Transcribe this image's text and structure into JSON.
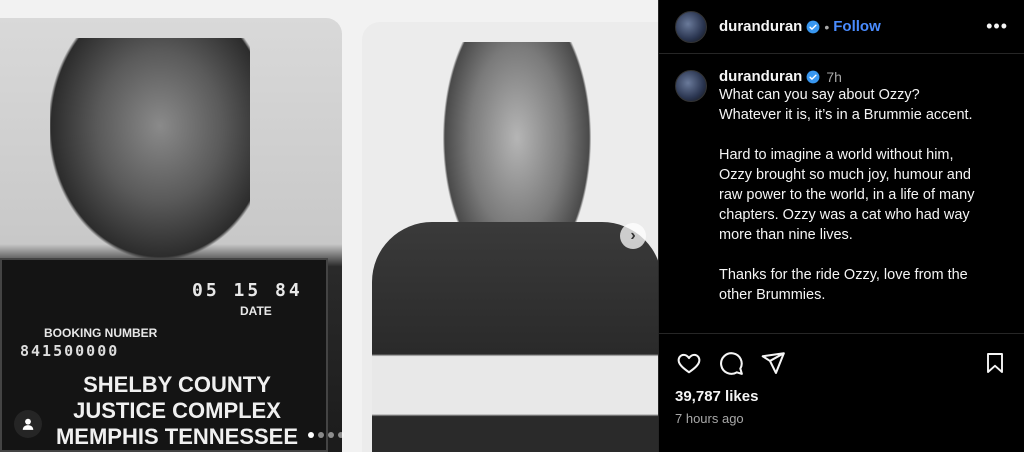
{
  "post": {
    "username": "duranduran",
    "follow_label": "Follow",
    "separator": "•",
    "more_label": "•••",
    "time_ago": "7h",
    "caption_lines": [
      "What can you say about Ozzy?",
      "Whatever it is, it’s in a Brummie accent.",
      "Hard to imagine a world without him,",
      "Ozzy brought so much joy, humour and",
      "raw power to the world, in a life of many",
      "chapters. Ozzy was a cat who had way",
      "more than nine lives.",
      "Thanks for the ride Ozzy, love from the",
      "other Brummies."
    ],
    "likes": "39,787 likes",
    "posted": "7 hours ago"
  },
  "media": {
    "placard_date": "05 15 84",
    "placard_date_label": "DATE",
    "placard_booking_label": "BOOKING NUMBER",
    "placard_booking_number": "841500000",
    "placard_county_1": "SHELBY COUNTY",
    "placard_county_2": "JUSTICE COMPLEX",
    "placard_county_3": "MEMPHIS TENNESSEE",
    "next_arrow": "›",
    "carousel_count": 4,
    "carousel_active": 1
  },
  "icons": {
    "verified": "verified-badge-icon",
    "like": "heart-icon",
    "comment": "comment-icon",
    "share": "paper-plane-icon",
    "save": "bookmark-icon",
    "tag": "user-tag-icon",
    "next": "chevron-right-icon"
  },
  "colors": {
    "background": "#000000",
    "text": "#f5f5f5",
    "secondary_text": "#a8a8a8",
    "accent": "#4a8cff",
    "verified": "#3897f0",
    "divider": "#262626"
  }
}
